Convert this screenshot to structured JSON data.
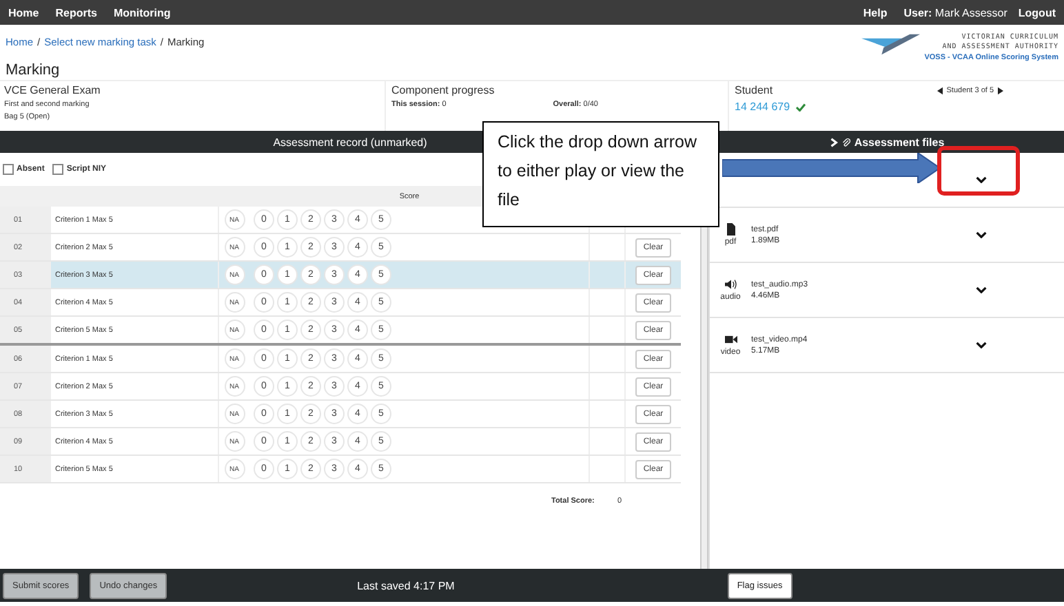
{
  "nav": {
    "left": [
      "Home",
      "Reports",
      "Monitoring"
    ],
    "help": "Help",
    "user_label": "User:",
    "user_name": "Mark Assessor",
    "logout": "Logout"
  },
  "breadcrumb": {
    "links": [
      "Home",
      "Select new marking task"
    ],
    "current": "Marking",
    "separator": "/"
  },
  "logo": {
    "line1": "VICTORIAN CURRICULUM",
    "line2": "AND ASSESSMENT AUTHORITY",
    "line3": "VOSS - VCAA Online Scoring System"
  },
  "page_title": "Marking",
  "exam": {
    "title": "VCE General Exam",
    "subtitle": "First and second marking",
    "bag": "Bag 5",
    "bag_status": "(Open)"
  },
  "progress": {
    "title": "Component progress",
    "session_label": "This session:",
    "session_value": "0",
    "overall_label": "Overall:",
    "overall_value": "0/40"
  },
  "student": {
    "title": "Student",
    "number": "14 244 679",
    "verified": true,
    "pager": "Student 3 of 5"
  },
  "record_header": "Assessment record (unmarked)",
  "files_header": "Assessment files",
  "checkboxes": [
    {
      "label": "Absent",
      "checked": false
    },
    {
      "label": "Script NIY",
      "checked": false
    }
  ],
  "table": {
    "score_heading": "Score",
    "rows": [
      {
        "number": "01",
        "criterion": "Criterion 1 Max 5",
        "na": "NA",
        "scores": [
          "0",
          "1",
          "2",
          "3",
          "4",
          "5"
        ],
        "selected": false
      },
      {
        "number": "02",
        "criterion": "Criterion 2 Max 5",
        "na": "NA",
        "scores": [
          "0",
          "1",
          "2",
          "3",
          "4",
          "5"
        ],
        "clear": "Clear",
        "selected": false
      },
      {
        "number": "03",
        "criterion": "Criterion 3 Max 5",
        "na": "NA",
        "scores": [
          "0",
          "1",
          "2",
          "3",
          "4",
          "5"
        ],
        "clear": "Clear",
        "selected": true
      },
      {
        "number": "04",
        "criterion": "Criterion 4 Max 5",
        "na": "NA",
        "scores": [
          "0",
          "1",
          "2",
          "3",
          "4",
          "5"
        ],
        "clear": "Clear",
        "selected": false
      },
      {
        "number": "05",
        "criterion": "Criterion 5 Max 5",
        "na": "NA",
        "scores": [
          "0",
          "1",
          "2",
          "3",
          "4",
          "5"
        ],
        "clear": "Clear",
        "selected": false,
        "group_end": true
      },
      {
        "number": "06",
        "criterion": "Criterion 1 Max 5",
        "na": "NA",
        "scores": [
          "0",
          "1",
          "2",
          "3",
          "4",
          "5"
        ],
        "clear": "Clear",
        "selected": false
      },
      {
        "number": "07",
        "criterion": "Criterion 2 Max 5",
        "na": "NA",
        "scores": [
          "0",
          "1",
          "2",
          "3",
          "4",
          "5"
        ],
        "clear": "Clear",
        "selected": false
      },
      {
        "number": "08",
        "criterion": "Criterion 3 Max 5",
        "na": "NA",
        "scores": [
          "0",
          "1",
          "2",
          "3",
          "4",
          "5"
        ],
        "clear": "Clear",
        "selected": false
      },
      {
        "number": "09",
        "criterion": "Criterion 4 Max 5",
        "na": "NA",
        "scores": [
          "0",
          "1",
          "2",
          "3",
          "4",
          "5"
        ],
        "clear": "Clear",
        "selected": false
      },
      {
        "number": "10",
        "criterion": "Criterion 5 Max 5",
        "na": "NA",
        "scores": [
          "0",
          "1",
          "2",
          "3",
          "4",
          "5"
        ],
        "clear": "Clear",
        "selected": false
      }
    ],
    "total_label": "Total Score:",
    "total_value": "0"
  },
  "files": [
    {
      "kind": "hidden"
    },
    {
      "kind": "pdf",
      "type_label": "pdf",
      "name": "test.pdf",
      "size": "1.89MB"
    },
    {
      "kind": "audio",
      "type_label": "audio",
      "name": "test_audio.mp3",
      "size": "4.46MB"
    },
    {
      "kind": "video",
      "type_label": "video",
      "name": "test_video.mp4",
      "size": "5.17MB"
    }
  ],
  "callout": {
    "text": "Click the drop down arrow to either play or view the file"
  },
  "footer": {
    "submit": "Submit scores",
    "undo": "Undo changes",
    "saved": "Last saved 4:17 PM",
    "flag": "Flag issues"
  }
}
